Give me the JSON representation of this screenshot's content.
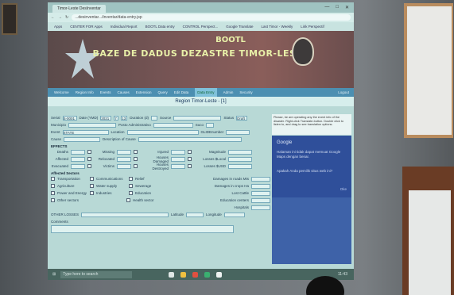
{
  "browser": {
    "tab_title": "Timor-Leste DesInventar",
    "address": "...desinventar.../inventar/data-entry.jsp",
    "bookmarks": [
      "Apps",
      "CENTER FOR Apps",
      "Individual Report",
      "BOOTL Data entry",
      "CONTROL Perspect...",
      "Google Translate",
      "Last Timor - Weekly",
      "Lirik Perspectif"
    ],
    "window_controls": [
      "—",
      "□",
      "✕"
    ]
  },
  "banner": {
    "line1": "BOOTL",
    "line2": "BAZE DE DADUS DEZASTRE TIMOR-LESTE"
  },
  "menu": {
    "items": [
      "Welcome",
      "Region Info",
      "Events",
      "Causes",
      "Extension",
      "Query",
      "Edit Data",
      "Data Entry",
      "Admin",
      "Security"
    ],
    "active_index": 7,
    "right": "Logout"
  },
  "region": {
    "text": "Region Timor-Leste - [1]"
  },
  "form": {
    "row1": {
      "serial_label": "Serial",
      "serial_value": "S-0001",
      "date_label": "Date (YMD)",
      "date_y": "2021",
      "date_m": "7",
      "date_d": "13",
      "duration_label": "Duration (d)",
      "source_label": "Source",
      "status_label": "Status",
      "status_value": "Draft"
    },
    "row2": {
      "province_label": "Municipio",
      "admin_label": "Posto Administrativo",
      "level_label": "Suco"
    },
    "row3": {
      "event_label": "Event",
      "event_value": "STATE",
      "location_label": "Location",
      "glide_label": "GLIDEnumber"
    },
    "row4": {
      "cause_label": "Cause",
      "desc_label": "Description of Cause"
    },
    "effects_label": "EFFECTS",
    "effects_col1": [
      "Deaths",
      "Affected",
      "Evacuated"
    ],
    "effects_col2": [
      "Missing",
      "Relocated",
      "Victims"
    ],
    "effects_col3": [
      "Injured",
      "Houses Damaged",
      "Houses Destroyed"
    ],
    "effects_right": [
      "Magnitude",
      "Losses $Local",
      "Losses $USD"
    ],
    "sectors_label": "Affected Sectors",
    "sectors": [
      [
        "Transportation",
        "Communications",
        "Relief"
      ],
      [
        "Agriculture",
        "Water supply",
        "Sewerage"
      ],
      [
        "Power and Energy",
        "Industries",
        "Education"
      ],
      [
        "Other sectors",
        "",
        "Health sector"
      ]
    ],
    "damages": [
      "Damages in roads Mts",
      "Damages in crops Ha",
      "Lost Cattle",
      "Education centers",
      "Hospitals"
    ],
    "other_losses_label": "OTHER LOSSES",
    "latitude_label": "Latitude",
    "longitude_label": "Longitude",
    "comments_label": "Comments"
  },
  "notice": {
    "text": "Please, be are operating any the event info of the disaster. Right-click Translate-button. Double click to listen to, and drag to see translation options."
  },
  "google_box": {
    "title": "Google",
    "body": "Halaman ini tidak dapat memuat Google Maps dengan benar.",
    "link": "Apakah Anda pemilik situs web ini?",
    "button": "Oke"
  },
  "taskbar": {
    "search": "Type here to search",
    "clock": "11:43"
  },
  "colors": {
    "banner": "#7a5656",
    "menu": "#4c8fb1",
    "screen": "#b8d9d6",
    "google": "#2f4f9a"
  }
}
